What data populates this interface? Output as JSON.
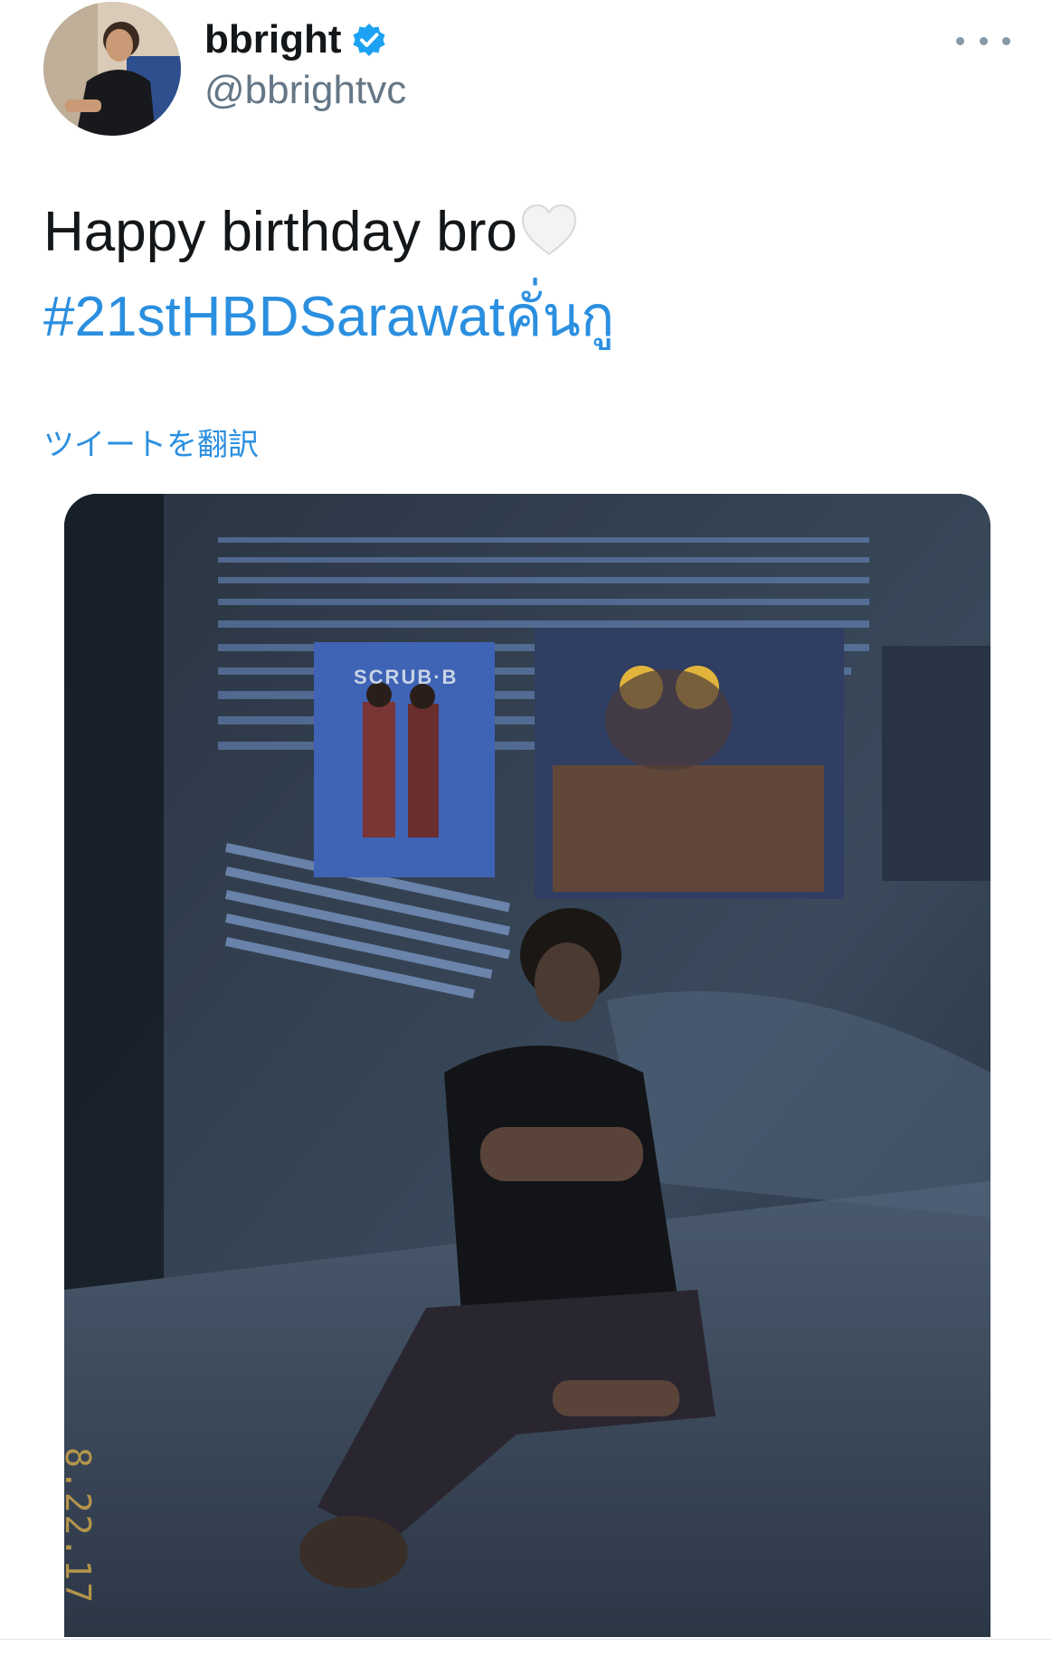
{
  "user": {
    "display_name": "bbright",
    "handle": "@bbrightvc",
    "verified": true,
    "avatar_icon": "profile-avatar"
  },
  "header": {
    "more_icon": "more-horizontal-icon"
  },
  "tweet": {
    "text": "Happy birthday bro",
    "emoji": "white-heart-icon",
    "hashtag": "#21stHBDSarawatคั่นกู",
    "translate_label": "ツイートを翻訳"
  },
  "media": {
    "poster_text": "SCRUB·B",
    "date_stamp": "8.22.17"
  },
  "colors": {
    "link": "#2b8fe0",
    "verified": "#1da1f2",
    "text": "#14171a",
    "secondary": "#657786"
  }
}
